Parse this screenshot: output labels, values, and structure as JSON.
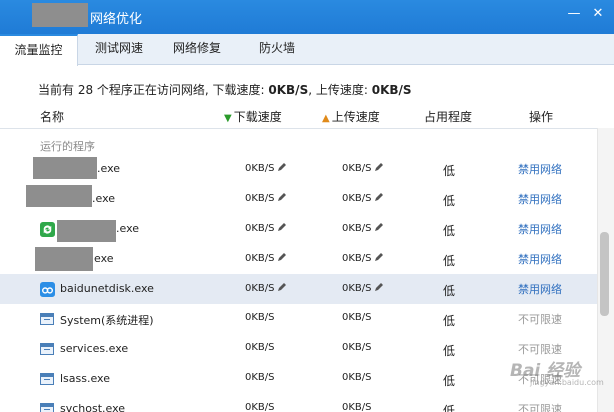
{
  "window": {
    "title": "网络优化",
    "minimize_glyph": "—",
    "close_glyph": "✕"
  },
  "tabs": [
    {
      "label": "流量监控",
      "active": true
    },
    {
      "label": "测试网速",
      "active": false
    },
    {
      "label": "网络修复",
      "active": false
    },
    {
      "label": "防火墙",
      "active": false
    }
  ],
  "summary": {
    "prefix": "当前有 28 个程序正在访问网络, 下载速度: ",
    "download": "0KB/S",
    "mid": ", 上传速度: ",
    "upload": "0KB/S"
  },
  "table": {
    "headers": {
      "name": "名称",
      "download": "下载速度",
      "upload": "上传速度",
      "level": "占用程度",
      "action": "操作"
    },
    "group_label": "运行的程序",
    "rows": [
      {
        "name": ".exe",
        "icon": "redacted",
        "download": "0KB/S",
        "upload": "0KB/S",
        "level": "低",
        "action": "禁用网络",
        "editable": true
      },
      {
        "name": ".exe",
        "icon": "redacted",
        "download": "0KB/S",
        "upload": "0KB/S",
        "level": "低",
        "action": "禁用网络",
        "editable": true
      },
      {
        "name": ".exe",
        "icon": "green-sync-icon",
        "download": "0KB/S",
        "upload": "0KB/S",
        "level": "低",
        "action": "禁用网络",
        "editable": true
      },
      {
        "name": "exe",
        "icon": "redacted",
        "download": "0KB/S",
        "upload": "0KB/S",
        "level": "低",
        "action": "禁用网络",
        "editable": true
      },
      {
        "name": "baidunetdisk.exe",
        "icon": "baidunetdisk-cloud-icon",
        "download": "0KB/S",
        "upload": "0KB/S",
        "level": "低",
        "action": "禁用网络",
        "editable": true,
        "selected": true
      },
      {
        "name": "System(系统进程)",
        "icon": "system-window-icon",
        "download": "0KB/S",
        "upload": "0KB/S",
        "level": "低",
        "action": "不可限速",
        "editable": false
      },
      {
        "name": "services.exe",
        "icon": "system-window-icon",
        "download": "0KB/S",
        "upload": "0KB/S",
        "level": "低",
        "action": "不可限速",
        "editable": false
      },
      {
        "name": "lsass.exe",
        "icon": "system-window-icon",
        "download": "0KB/S",
        "upload": "0KB/S",
        "level": "低",
        "action": "不可限速",
        "editable": false
      },
      {
        "name": "svchost.exe",
        "icon": "system-window-icon",
        "download": "0KB/S",
        "upload": "0KB/S",
        "level": "低",
        "action": "不可限速",
        "editable": false
      }
    ]
  },
  "watermark": {
    "text": "Bai 经验",
    "sub": "jingyan.baidu.com"
  },
  "colors": {
    "titlebar": "#1f7bd6",
    "link": "#2f6fbf",
    "disabled": "#9a9a9a",
    "selected_row": "#e4eaf3"
  }
}
